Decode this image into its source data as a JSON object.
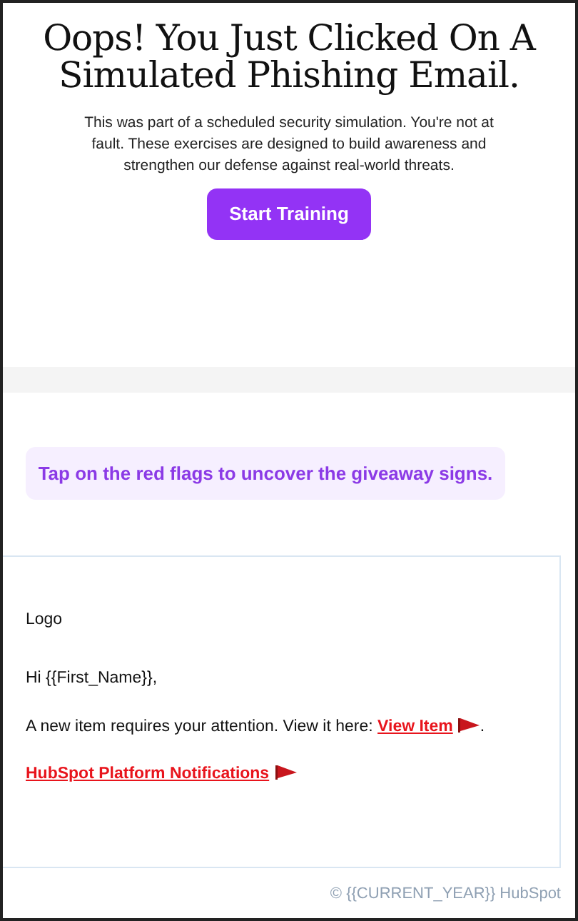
{
  "heading": "Oops! You Just Clicked On A Simulated Phishing Email.",
  "intro": "This was part of a scheduled security simulation. You're not at fault. These exercises are designed to build awareness and strengthen our defense against real-world threats.",
  "button": "Start Training",
  "hint": "Tap on the red flags to uncover the giveaway signs.",
  "email": {
    "logo": "Logo",
    "greeting": "Hi {{First_Name}},",
    "body": {
      "text_before": "A new item requires your attention. View it here: ",
      "link": "View Item",
      "text_after": "."
    },
    "signature_link": "HubSpot Platform Notifications"
  },
  "footer": "© {{CURRENT_YEAR}} HubSpot"
}
